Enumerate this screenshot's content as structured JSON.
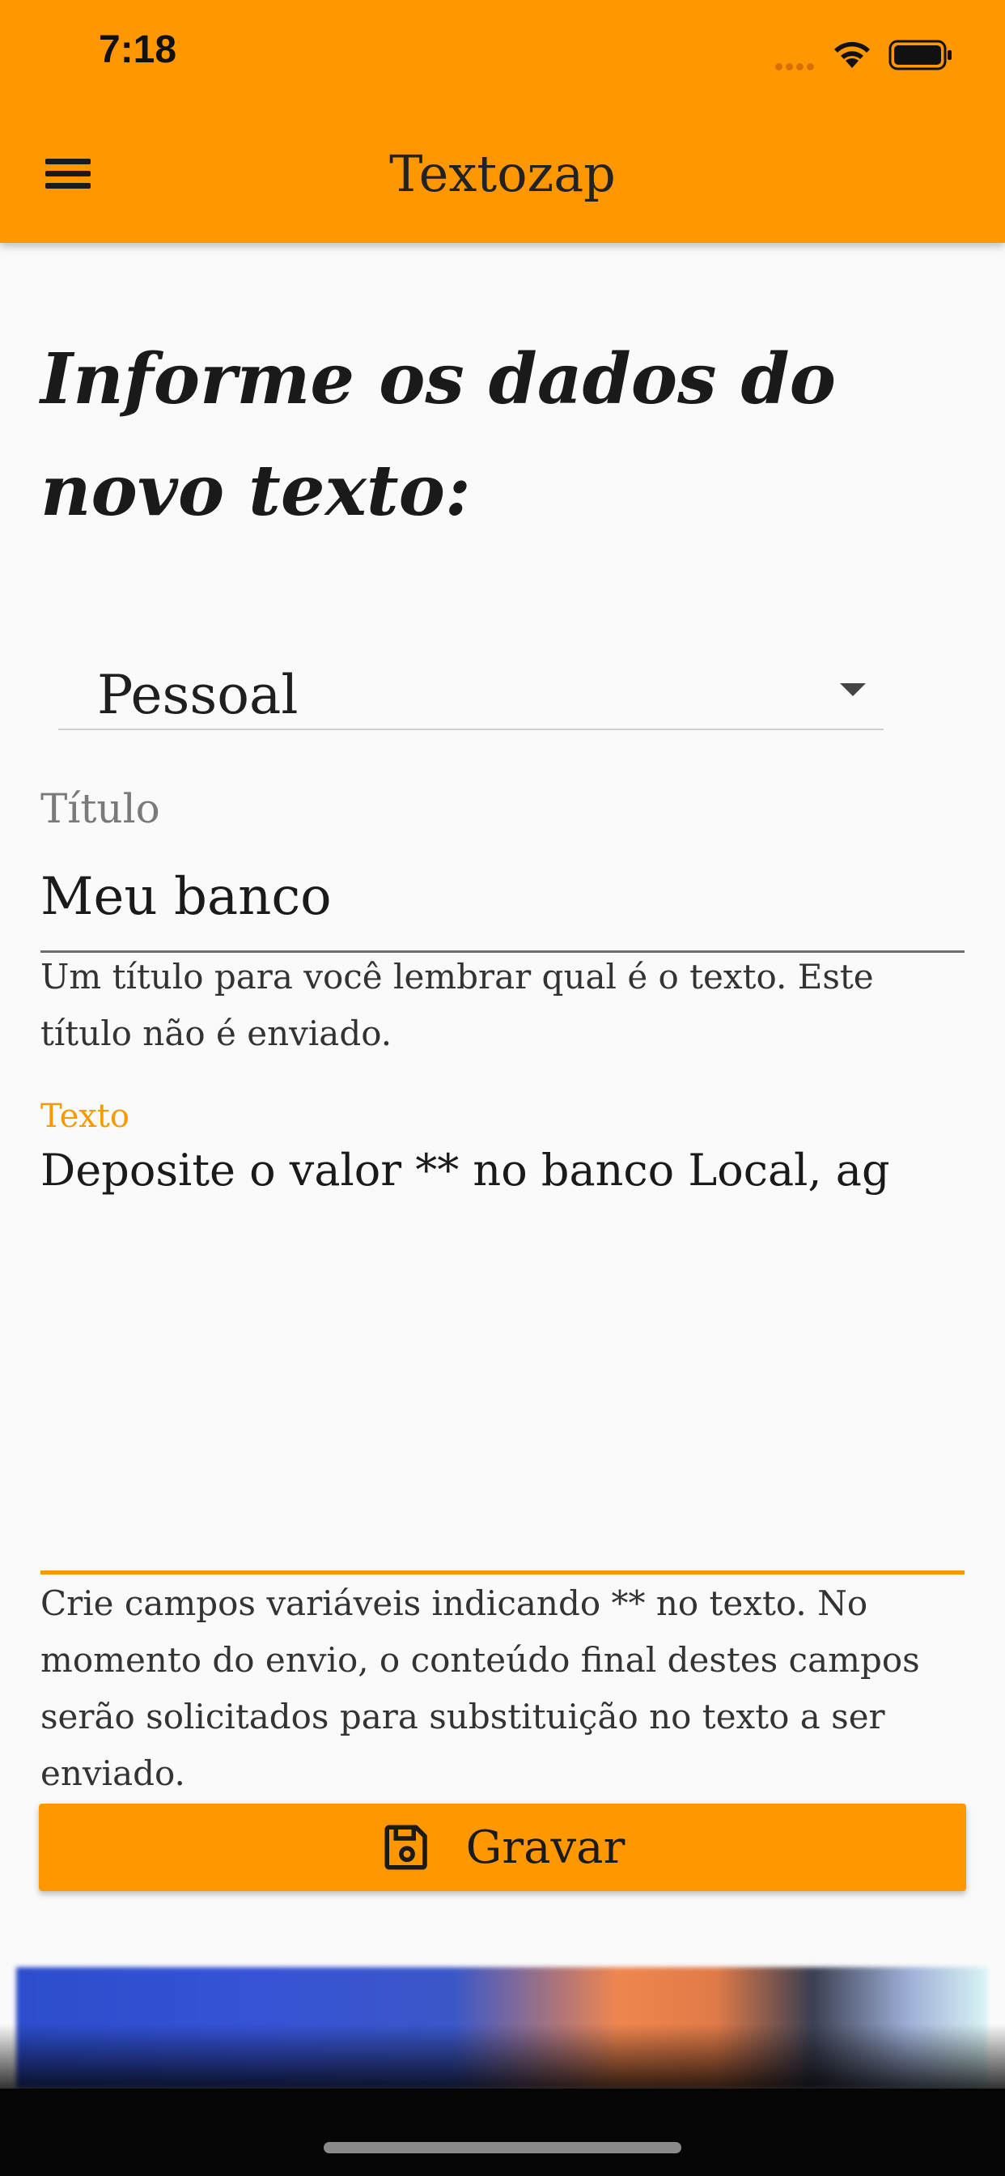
{
  "status_bar": {
    "time": "7:18"
  },
  "app_bar": {
    "title": "Textozap",
    "menu_icon": "hamburger-menu-icon"
  },
  "form": {
    "heading": "Informe os dados do novo texto:",
    "category": {
      "selected": "Pessoal"
    },
    "title_field": {
      "label": "Título",
      "value": "Meu banco",
      "helper": "Um título para você lembrar qual é o texto. Este título não é enviado."
    },
    "text_field": {
      "label": "Texto",
      "value": "Deposite o valor ** no banco Local, ag",
      "helper": "Crie campos variáveis indicando ** no texto. No momento do envio, o conteúdo final destes campos serão solicitados para substituição no texto a ser enviado."
    },
    "save_button": {
      "label": "Gravar",
      "icon": "floppy-disk-icon"
    }
  },
  "colors": {
    "primary": "#ff9800",
    "focus": "#f59a00",
    "background": "#fafafa"
  }
}
